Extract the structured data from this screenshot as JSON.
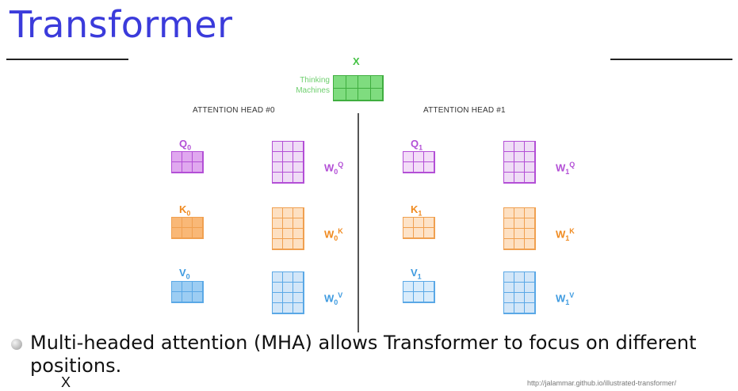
{
  "title": "Transformer",
  "x": {
    "label": "X",
    "caption_line1": "Thinking",
    "caption_line2": "Machines",
    "color": "#7fdc7f"
  },
  "heads": [
    {
      "title": "ATTENTION HEAD #0",
      "q": {
        "base": "Q",
        "sub": "0"
      },
      "k": {
        "base": "K",
        "sub": "0"
      },
      "v": {
        "base": "V",
        "sub": "0"
      },
      "wq": {
        "base": "W",
        "sub": "0",
        "sup": "Q"
      },
      "wk": {
        "base": "W",
        "sub": "0",
        "sup": "K"
      },
      "wv": {
        "base": "W",
        "sub": "0",
        "sup": "V"
      }
    },
    {
      "title": "ATTENTION HEAD #1",
      "q": {
        "base": "Q",
        "sub": "1"
      },
      "k": {
        "base": "K",
        "sub": "1"
      },
      "v": {
        "base": "V",
        "sub": "1"
      },
      "wq": {
        "base": "W",
        "sub": "1",
        "sup": "Q"
      },
      "wk": {
        "base": "W",
        "sub": "1",
        "sup": "K"
      },
      "wv": {
        "base": "W",
        "sub": "1",
        "sup": "V"
      }
    }
  ],
  "colors": {
    "title": "#3b3bdb",
    "query_text": "#b34fd6",
    "key_text": "#f08a1f",
    "value_text": "#3f9be0",
    "q_head0": "#e0a8ef",
    "q_head1": "#f3ddf8",
    "k_head0": "#f9b877",
    "k_head1": "#fde3c8",
    "v_head0": "#9ccdf3",
    "v_head1": "#d9ecfb",
    "w_q": "#efdcf6",
    "w_k": "#fde0c2",
    "w_v": "#d2e6f8",
    "grid_q": "#b34fd6",
    "grid_k": "#f0a050",
    "grid_v": "#5aa8e6"
  },
  "bullet": "Multi-headed attention (MHA) allows Transformer to focus on different positions.",
  "source_url": "http://jalammar.github.io/illustrated-transformer/",
  "cut_glyph": "X"
}
